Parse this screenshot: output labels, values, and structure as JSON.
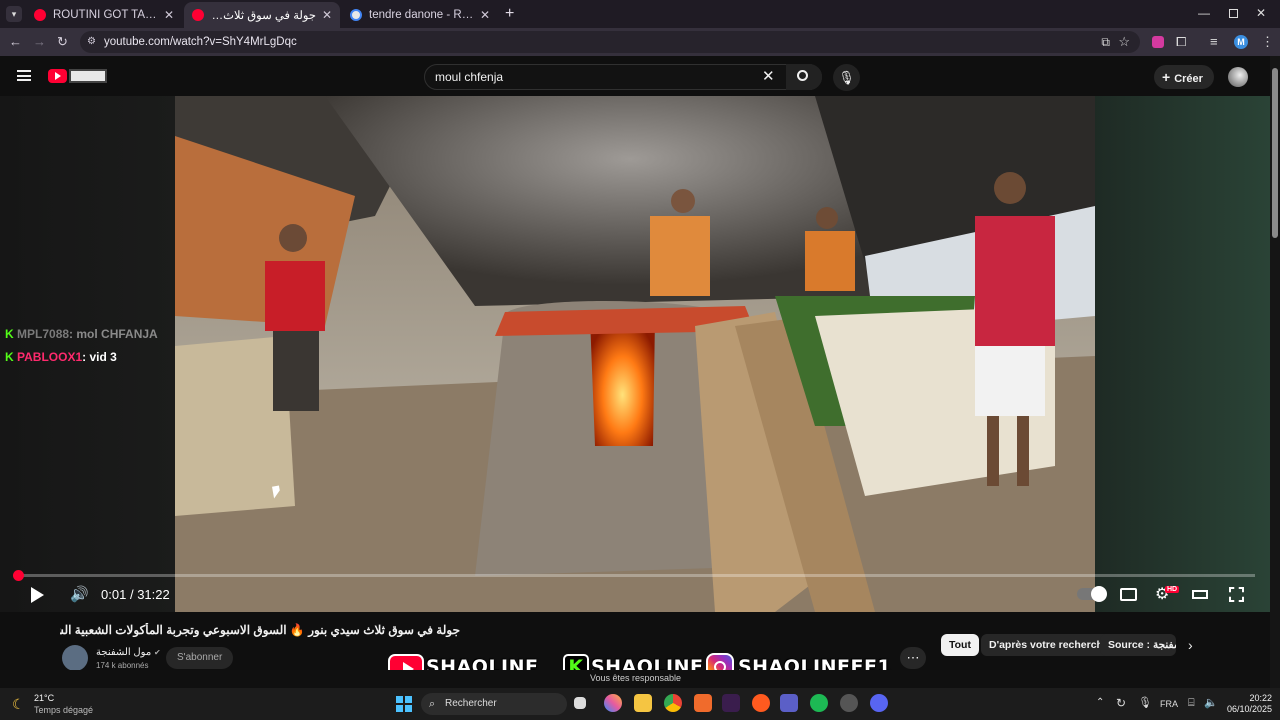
{
  "browser": {
    "tabs": [
      {
        "title": "ROUTINI GOT TALENT - YouTube",
        "favicon_color": "#ff0033"
      },
      {
        "title": "جولة في سوق ثلاث سيدي بنور 🔥",
        "favicon_color": "#ff0033"
      },
      {
        "title": "tendre danone - Recherche Goo",
        "favicon_color": "#e8e8e8"
      }
    ],
    "new_tab": "+",
    "url": "youtube.com/watch?v=ShY4MrLgDqc",
    "profile_initial": "M"
  },
  "youtube": {
    "search_query": "moul chfenja",
    "create_label": "Créer",
    "brand_color": "#ff0033"
  },
  "chat": [
    {
      "user": "MPL7088",
      "message": ": mol CHFANJA",
      "user_color": "#7a7a7a"
    },
    {
      "user": "PABLOOX1",
      "message": ": vid 3",
      "user_color": "#ff2a6d"
    }
  ],
  "player": {
    "time_current": "0:01",
    "time_separator": "/",
    "time_total": "31:22",
    "progress": 0.0005,
    "hd_badge": "HD"
  },
  "video": {
    "title": "جولة في سوق ثلاث سيدي بنور 🔥 السوق الاسبوعي وتجربة المأكولات الشعبية الشهية MA",
    "channel": "مول الشفنجة",
    "subscribers": "174 k abonnés",
    "subscribe_label": "S'abonner",
    "more": "⋯"
  },
  "chips": [
    "Tout",
    "D'après votre recherche",
    "Source : الشفنجة"
  ],
  "overlay": {
    "logos": [
      "SHAOLINE",
      "SHAOLINE",
      "SHAOLINEEE1"
    ],
    "bottom_text": "Vous êtes responsable"
  },
  "taskbar": {
    "weather_temp": "21°C",
    "weather_desc": "Temps dégagé",
    "search_placeholder": "Rechercher",
    "lang": "FRA",
    "time": "20:22",
    "date": "06/10/2025"
  }
}
